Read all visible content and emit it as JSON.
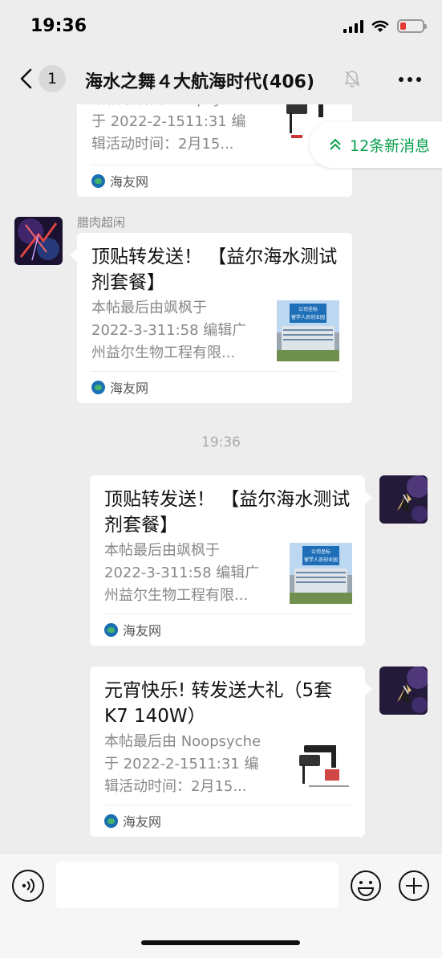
{
  "status_bar": {
    "time": "19:36",
    "battery_color": "#e53935"
  },
  "nav": {
    "unread_count": "1",
    "title": "海水之舞４大航海时代(406)"
  },
  "new_messages_pill": {
    "label": "12条新消息",
    "color": "#07a04e"
  },
  "messages": [
    {
      "kind": "link-card",
      "direction": "incoming",
      "title": "",
      "desc_lines": [
        "本帖最后由 Noopsyche",
        "于 2022-2-1511:31 编",
        "辑活动时间：2月15..."
      ],
      "thumb": "light-fixture",
      "source": "海友网"
    },
    {
      "kind": "link-card",
      "direction": "incoming",
      "sender": "腊肉超闲",
      "title": "顶贴转发送！ 【益尔海水测试剂套餐】",
      "desc_lines": [
        "本帖最后由飒枫于",
        "2022-3-311:58 编辑广",
        "州益尔生物工程有限..."
      ],
      "thumb": "building",
      "thumb_banner": [
        "公司坐标",
        "留学人员创业园"
      ],
      "source": "海友网"
    },
    {
      "kind": "time",
      "text": "19:36"
    },
    {
      "kind": "link-card",
      "direction": "outgoing",
      "title": "顶贴转发送！ 【益尔海水测试剂套餐】",
      "desc_lines": [
        "本帖最后由飒枫于",
        "2022-3-311:58 编辑广",
        "州益尔生物工程有限..."
      ],
      "thumb": "building",
      "thumb_banner": [
        "公司坐标",
        "留学人员创业园"
      ],
      "source": "海友网"
    },
    {
      "kind": "link-card",
      "direction": "outgoing",
      "title": "元宵快乐! 转发送大礼（5套 K7  140W）",
      "desc_lines": [
        "本帖最后由 Noopsyche",
        "于 2022-2-1511:31 编",
        "辑活动时间：2月15..."
      ],
      "thumb": "light-fixture",
      "source": "海友网"
    }
  ],
  "input_bar": {
    "placeholder": ""
  }
}
